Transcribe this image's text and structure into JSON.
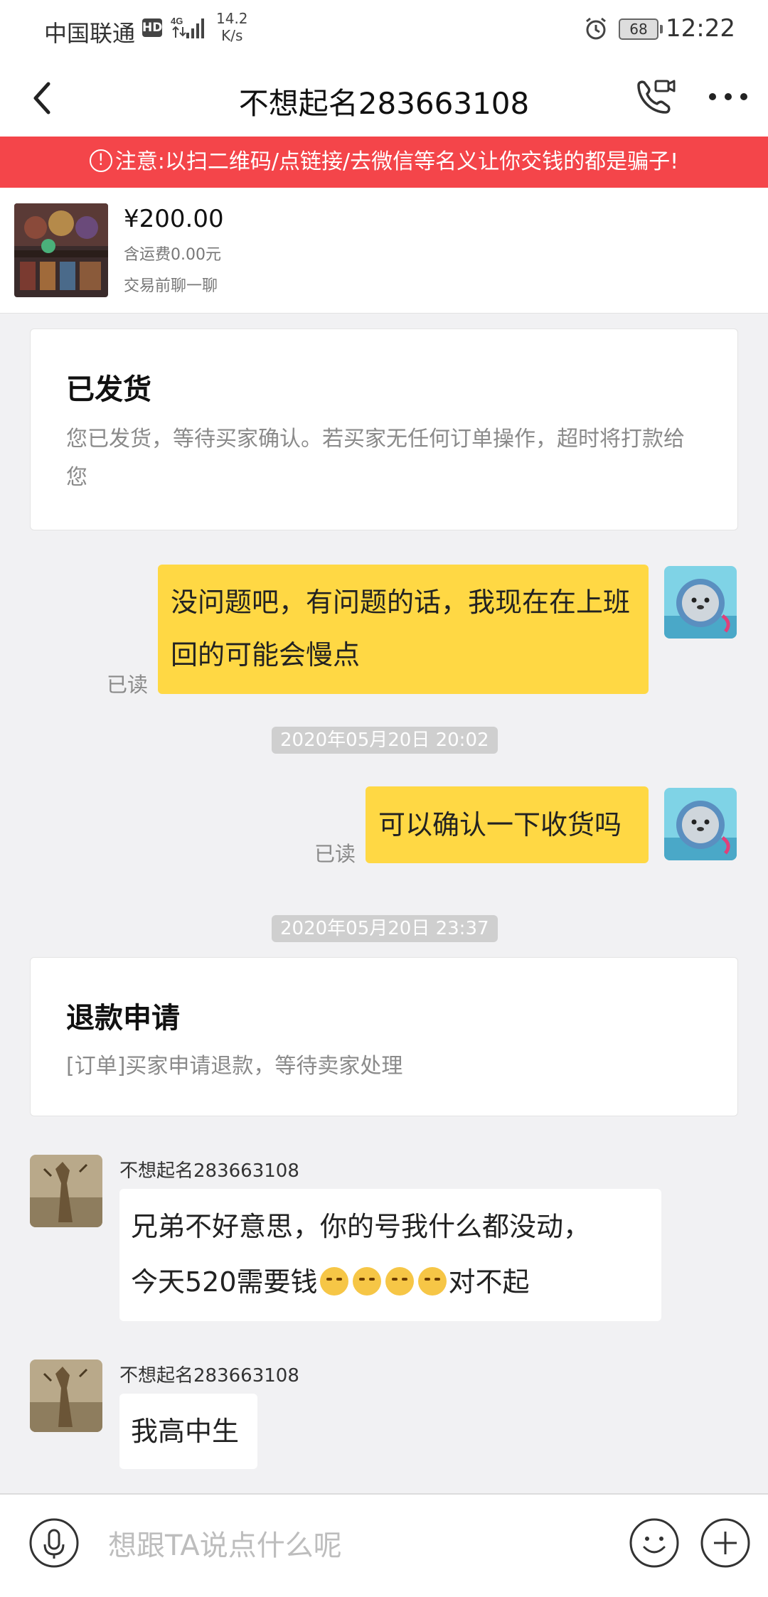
{
  "status_bar": {
    "carrier": "中国联通",
    "hd": "HD",
    "network": "4G",
    "speed_value": "14.2",
    "speed_unit": "K/s",
    "battery": "68",
    "time": "12:22"
  },
  "nav": {
    "title": "不想起名283663108"
  },
  "warning": {
    "text": "注意:以扫二维码/点链接/去微信等名义让你交钱的都是骗子!"
  },
  "product": {
    "price": "¥200.00",
    "shipping": "含运费0.00元",
    "chat_note": "交易前聊一聊"
  },
  "shipped_card": {
    "title": "已发货",
    "description": "您已发货，等待买家确认。若买家无任何订单操作，超时将打款给您"
  },
  "messages": {
    "msg1": {
      "text": "没问题吧，有问题的话，我现在在上班回的可能会慢点",
      "status": "已读"
    },
    "timestamp1": "2020年05月20日 20:02",
    "msg2": {
      "text": "可以确认一下收货吗",
      "status": "已读"
    },
    "timestamp2": "2020年05月20日 23:37",
    "msg3": {
      "sender": "不想起名283663108",
      "line1": "兄弟不好意思，你的号我什么都没动，",
      "line2_prefix": "今天520需要钱",
      "line2_suffix": "对不起",
      "emoji_count": 4
    },
    "msg4": {
      "sender": "不想起名283663108",
      "text": "我高中生"
    }
  },
  "refund_card": {
    "title": "退款申请",
    "description": "[订单]买家申请退款，等待卖家处理"
  },
  "input_bar": {
    "placeholder": "想跟TA说点什么呢"
  },
  "icons": {
    "back": "chevron-left-icon",
    "call": "phone-video-icon",
    "more": "more-dots-icon",
    "warning": "warning-circle-icon",
    "mic": "microphone-icon",
    "emoji": "emoji-smile-icon",
    "add": "plus-circle-icon"
  },
  "colors": {
    "warning_bg": "#f4454a",
    "my_bubble": "#ffd844",
    "background": "#f1f1f3"
  }
}
